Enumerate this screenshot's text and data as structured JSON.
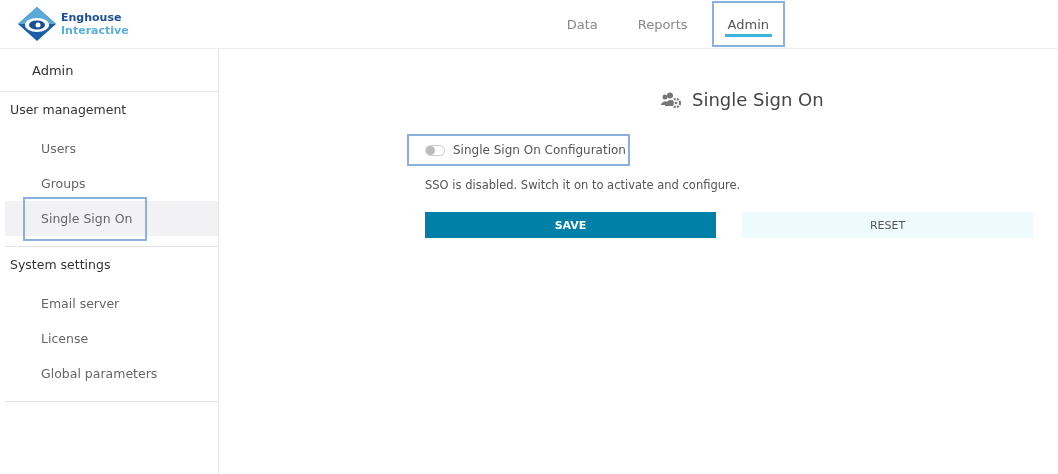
{
  "logo": {
    "line1": "Enghouse",
    "line2": "Interactive"
  },
  "tabs": [
    {
      "label": "Data",
      "selected": false,
      "highlighted": false
    },
    {
      "label": "Reports",
      "selected": false,
      "highlighted": false
    },
    {
      "label": "Admin",
      "selected": true,
      "highlighted": true
    }
  ],
  "sidebar": {
    "title": "Admin",
    "sections": [
      {
        "heading": "User management",
        "items": [
          {
            "label": "Users",
            "selected": false,
            "highlighted": false
          },
          {
            "label": "Groups",
            "selected": false,
            "highlighted": false
          },
          {
            "label": "Single Sign On",
            "selected": true,
            "highlighted": true
          }
        ]
      },
      {
        "heading": "System settings",
        "items": [
          {
            "label": "Email server",
            "selected": false,
            "highlighted": false
          },
          {
            "label": "License",
            "selected": false,
            "highlighted": false
          },
          {
            "label": "Global parameters",
            "selected": false,
            "highlighted": false
          }
        ]
      }
    ]
  },
  "page": {
    "title": "Single Sign On",
    "toggle": {
      "label": "Single Sign On Configuration",
      "on": false,
      "highlighted": true
    },
    "message": "SSO is disabled. Switch it on to activate and configure.",
    "buttons": [
      {
        "label": "SAVE",
        "kind": "primary"
      },
      {
        "label": "RESET",
        "kind": "secondary"
      }
    ]
  }
}
